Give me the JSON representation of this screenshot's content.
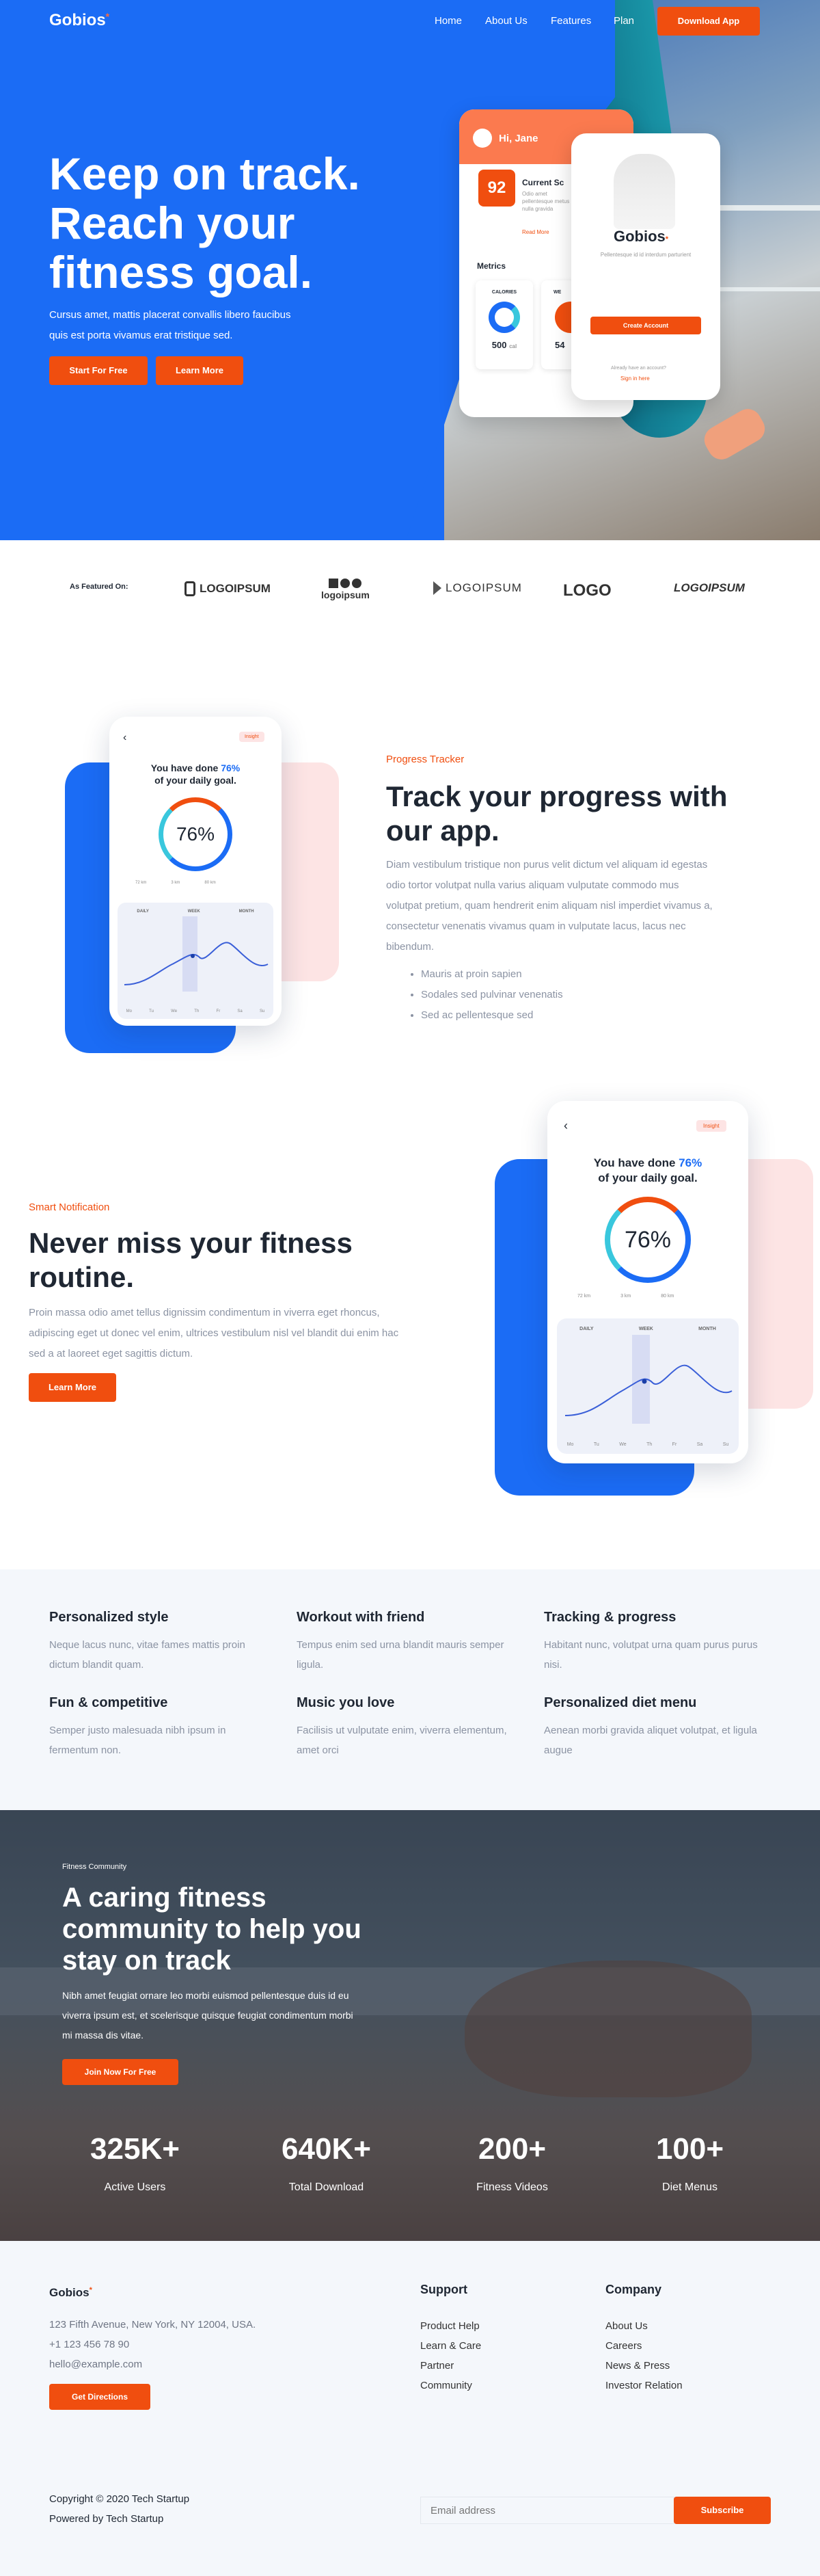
{
  "brand": {
    "name": "Gobios",
    "mark": "*"
  },
  "nav": {
    "home": "Home",
    "about": "About Us",
    "features": "Features",
    "plan": "Plan",
    "download": "Download App"
  },
  "hero": {
    "line1": "Keep on track.",
    "line2": "Reach your",
    "line3": "fitness goal.",
    "sub1": "Cursus amet, mattis placerat convallis libero faucibus",
    "sub2": "quis est porta vivamus erat tristique sed.",
    "start": "Start For Free",
    "learn": "Learn More"
  },
  "heroApp": {
    "greet": "Hi, Jane",
    "score": "92",
    "scoreTitle": "Current Sc",
    "scoreText": "Odio amet pellentesque metus nulla gravida",
    "readmore": "Read More",
    "metrics": "Metrics",
    "calories": "CALORIES",
    "calVal": "500",
    "calUnit": "cal",
    "weight": "WE",
    "weightVal": "54",
    "brand": "Gobios",
    "desc": "Pellentesque id id interdum parturient",
    "create": "Create Account",
    "already": "Already have an account?",
    "signin": "Sign in here"
  },
  "featured": {
    "label": "As Featured On:",
    "logos": [
      "LOGOIPSUM",
      "logoipsum",
      "LOGOIPSUM",
      "LOGO",
      "LOGOIPSUM"
    ]
  },
  "tracker": {
    "eyebrow": "Progress Tracker",
    "title1": "Track your progress with",
    "title2": "our app.",
    "para": [
      "Diam vestibulum tristique non purus velit dictum vel aliquam id egestas",
      "odio tortor volutpat nulla varius aliquam vulputate commodo mus",
      "volutpat pretium, quam hendrerit enim aliquam nisl imperdiet vivamus a,",
      "consectetur venenatis vivamus quam in vulputate lacus, lacus nec",
      "bibendum."
    ],
    "bullets": [
      "Mauris at proin sapien",
      "Sodales sed pulvinar venenatis",
      "Sed ac pellentesque sed"
    ]
  },
  "phoneApp": {
    "insight": "Insight",
    "done1": "You have done",
    "pct": "76%",
    "done2": "of your daily goal.",
    "big": "76%",
    "legend": [
      "72 km",
      "3 km",
      "80 km"
    ],
    "tabs": [
      "DAILY",
      "WEEK",
      "MONTH"
    ],
    "days": [
      "Mo",
      "Tu",
      "We",
      "Th",
      "Fr",
      "Sa",
      "Su"
    ]
  },
  "notify": {
    "eyebrow": "Smart Notification",
    "title1": "Never miss your fitness",
    "title2": "routine.",
    "para": [
      "Proin massa odio amet tellus dignissim condimentum in viverra eget rhoncus,",
      "adipiscing eget ut donec vel enim, ultrices vestibulum nisl vel blandit dui enim hac",
      "sed a at laoreet eget sagittis dictum."
    ],
    "learn": "Learn More"
  },
  "features": [
    {
      "title": "Personalized style",
      "text": [
        "Neque lacus nunc, vitae fames mattis proin",
        "dictum blandit quam."
      ]
    },
    {
      "title": "Workout with friend",
      "text": [
        "Tempus enim sed urna blandit mauris semper",
        "ligula."
      ]
    },
    {
      "title": "Tracking & progress",
      "text": [
        "Habitant nunc, volutpat urna quam purus purus",
        "nisi."
      ]
    },
    {
      "title": "Fun & competitive",
      "text": [
        "Semper justo malesuada nibh ipsum in",
        "fermentum non."
      ]
    },
    {
      "title": "Music you love",
      "text": [
        "Facilisis ut vulputate enim, viverra elementum,",
        "amet orci"
      ]
    },
    {
      "title": "Personalized diet menu",
      "text": [
        "Aenean morbi gravida aliquet volutpat, et ligula",
        "augue"
      ]
    }
  ],
  "community": {
    "eyebrow": "Fitness Community",
    "title": [
      "A caring fitness",
      "community to help you",
      "stay on track"
    ],
    "para": [
      "Nibh amet feugiat ornare leo morbi euismod pellentesque duis id eu",
      "viverra ipsum est, et scelerisque quisque feugiat condimentum morbi",
      "mi massa dis vitae."
    ],
    "join": "Join Now For Free"
  },
  "stats": [
    {
      "n": "325K+",
      "l": "Active Users"
    },
    {
      "n": "640K+",
      "l": "Total Download"
    },
    {
      "n": "200+",
      "l": "Fitness Videos"
    },
    {
      "n": "100+",
      "l": "Diet Menus"
    }
  ],
  "footer": {
    "brand": "Gobios",
    "address": "123 Fifth Avenue, New York, NY 12004, USA.",
    "phone": "+1 123 456 78 90",
    "email": "hello@example.com",
    "directions": "Get Directions",
    "supportTitle": "Support",
    "support": [
      "Product Help",
      "Learn & Care",
      "Partner",
      "Community"
    ],
    "companyTitle": "Company",
    "company": [
      "About Us",
      "Careers",
      "News & Press",
      "Investor Relation"
    ],
    "copyright": "Copyright © 2020 Tech Startup",
    "powered": "Powered by Tech Startup",
    "emailPh": "Email address",
    "subscribe": "Subscribe"
  },
  "colors": {
    "blue": "#1b6cf5",
    "orange": "#f04e0f",
    "pink": "#fde4e4"
  }
}
